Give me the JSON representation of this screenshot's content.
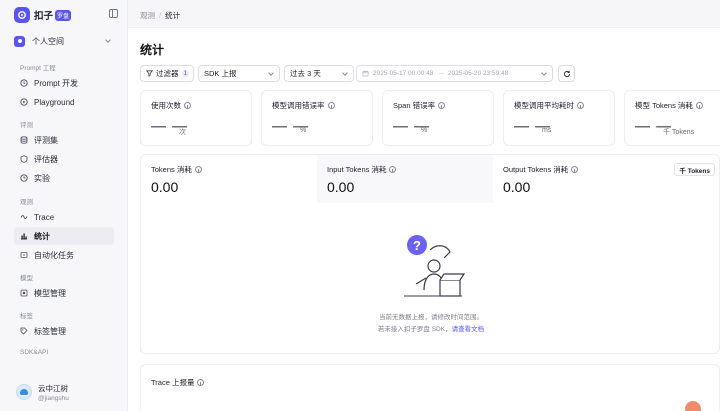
{
  "brand": {
    "name": "扣子",
    "badge": "罗盘"
  },
  "workspace": {
    "name": "个人空间"
  },
  "sidebar": {
    "sections": [
      {
        "label": "Prompt 工程",
        "items": [
          {
            "label": "Prompt 开发",
            "icon": "prompt-icon"
          },
          {
            "label": "Playground",
            "icon": "playground-icon"
          }
        ]
      },
      {
        "label": "评测",
        "items": [
          {
            "label": "评测集",
            "icon": "dataset-icon"
          },
          {
            "label": "评估器",
            "icon": "evaluator-icon"
          },
          {
            "label": "实验",
            "icon": "experiment-icon"
          }
        ]
      },
      {
        "label": "观测",
        "items": [
          {
            "label": "Trace",
            "icon": "trace-icon"
          },
          {
            "label": "统计",
            "icon": "stats-icon",
            "active": true
          },
          {
            "label": "自动化任务",
            "icon": "automation-icon"
          }
        ]
      },
      {
        "label": "模型",
        "items": [
          {
            "label": "模型管理",
            "icon": "model-icon"
          }
        ]
      },
      {
        "label": "标签",
        "items": [
          {
            "label": "标签管理",
            "icon": "tag-icon"
          }
        ]
      },
      {
        "label": "SDK&API",
        "items": []
      }
    ]
  },
  "user": {
    "name": "云中江树",
    "handle": "@jiangshu"
  },
  "breadcrumb": {
    "parent": "观测",
    "separator": "/",
    "current": "统计"
  },
  "page": {
    "title": "统计"
  },
  "toolbar": {
    "filter_label": "过滤器",
    "filter_count": "1",
    "source_select": "SDK 上报",
    "period_select": "过去 3 天",
    "date_start": "2025-05-17 00:00:48",
    "date_end": "2025-05-20 23:59:48",
    "date_arrow": "→"
  },
  "metrics": [
    {
      "label": "使用次数",
      "value": "— —",
      "unit": "次"
    },
    {
      "label": "模型调用错误率",
      "value": "— —",
      "unit": "%"
    },
    {
      "label": "Span 错误率",
      "value": "— —",
      "unit": "%"
    },
    {
      "label": "模型调用平均耗时",
      "value": "— —",
      "unit": "ms"
    },
    {
      "label": "模型 Tokens 消耗",
      "value": "— —",
      "unit": "千 Tokens"
    }
  ],
  "tokens": {
    "unit_tag": "千 Tokens",
    "columns": [
      {
        "label": "Tokens 消耗",
        "value": "0.00"
      },
      {
        "label": "Input Tokens 消耗",
        "value": "0.00"
      },
      {
        "label": "Output Tokens 消耗",
        "value": "0.00"
      }
    ],
    "empty_line1": "当前无数据上报，请修改时间范围。",
    "empty_line2_prefix": "若未接入扣子罗盘 SDK，",
    "empty_link": "请查看文档"
  },
  "trace": {
    "label": "Trace 上报量"
  },
  "colors": {
    "accent": "#5b55f0"
  }
}
